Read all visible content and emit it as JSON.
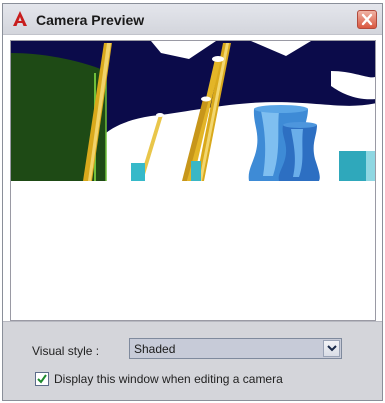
{
  "window": {
    "title": "Camera Preview",
    "app_icon": "autocad-a-icon",
    "close_icon": "close-icon"
  },
  "settings": {
    "visual_style_label": "Visual style :",
    "visual_style_value": "Shaded",
    "display_checkbox_label": "Display this window when editing a camera",
    "display_checkbox_checked": true
  },
  "colors": {
    "sky": "#0b0b4a",
    "ground_block": "#1f4a14",
    "pole": "#e0b122",
    "cyan_objects": "#36b9c9",
    "blue_objects": "#3e8bd6"
  }
}
